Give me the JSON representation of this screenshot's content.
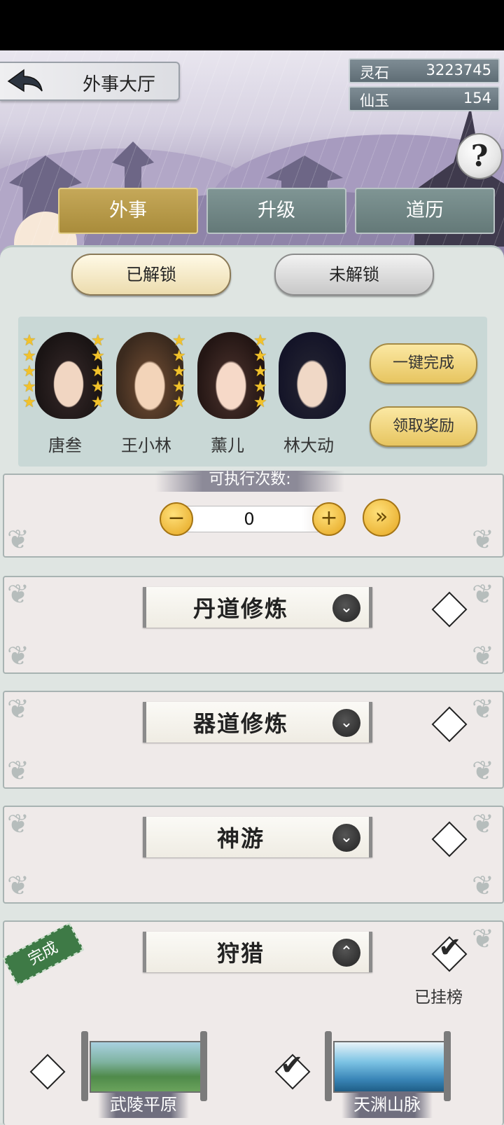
{
  "header": {
    "title": "外事大厅",
    "resources": [
      {
        "label": "灵石",
        "value": "3223745"
      },
      {
        "label": "仙玉",
        "value": "154"
      }
    ],
    "help_symbol": "?"
  },
  "tabs": [
    {
      "label": "外事",
      "active": true
    },
    {
      "label": "升级",
      "active": false
    },
    {
      "label": "道历",
      "active": false
    }
  ],
  "unlock_filter": {
    "unlocked": "已解锁",
    "locked": "未解锁",
    "selected": "已解锁"
  },
  "heroes": [
    {
      "name": "唐叁",
      "stars": 5
    },
    {
      "name": "王小林",
      "stars": 5
    },
    {
      "name": "薰儿",
      "stars": 5
    },
    {
      "name": "林大动",
      "stars": 5
    }
  ],
  "actions": {
    "complete_all": "一键完成",
    "claim_rewards": "领取奖励"
  },
  "executions": {
    "label": "可执行次数:",
    "value": "0",
    "minus": "−",
    "plus": "+",
    "max": "»"
  },
  "sections": [
    {
      "title": "丹道修炼",
      "expanded": false,
      "checked": false
    },
    {
      "title": "器道修炼",
      "expanded": false,
      "checked": false
    },
    {
      "title": "神游",
      "expanded": false,
      "checked": false
    },
    {
      "title": "狩猎",
      "expanded": true,
      "checked": true,
      "status": "已挂榜",
      "badge": "完成"
    }
  ],
  "hunt_maps": [
    {
      "name": "武陵平原",
      "checked": false
    },
    {
      "name": "天渊山脉",
      "checked": true
    }
  ],
  "colors": {
    "active_tab": "#b89a48",
    "tab": "#728786",
    "gold_button": "#f0d27a",
    "done_badge": "#3e7a46"
  }
}
